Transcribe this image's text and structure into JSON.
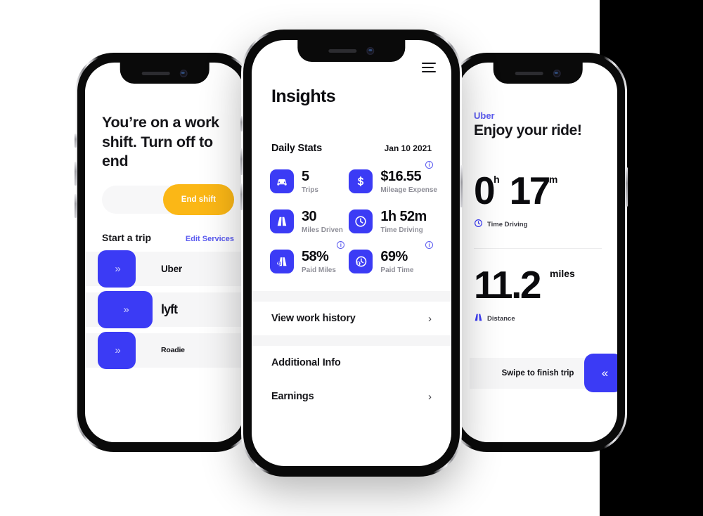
{
  "background": {
    "left_color": "#ffffff",
    "right_panel_color": "#000000"
  },
  "theme": {
    "accent_blue": "#3b3bf5",
    "link_blue": "#5b5bf0",
    "accent_yellow": "#fbb716",
    "text_dark": "#0c0c10",
    "muted": "#8f8f98",
    "band": "#f5f5f6"
  },
  "left_phone": {
    "heading": "You’re on a work shift. Turn off to end",
    "end_shift_label": "End shift",
    "start_trip_label": "Start a trip",
    "edit_services_label": "Edit Services",
    "services": [
      {
        "name": "Uber",
        "swipe_icon": "chevrons-right-icon"
      },
      {
        "name": "lyft",
        "swipe_icon": "chevrons-right-icon"
      },
      {
        "name": "Roadie",
        "swipe_icon": "chevrons-right-icon"
      }
    ]
  },
  "center_phone": {
    "menu_icon": "hamburger-menu-icon",
    "title": "Insights",
    "daily_stats_title": "Daily Stats",
    "date": "Jan 10 2021",
    "stats": [
      {
        "value": "5",
        "label": "Trips",
        "icon": "car-icon",
        "info": false
      },
      {
        "value": "$16.55",
        "label": "Mileage Expense",
        "icon": "dollar-icon",
        "info": true
      },
      {
        "value": "30",
        "label": "Miles  Driven",
        "icon": "road-icon",
        "info": false
      },
      {
        "value": "1h 52m",
        "label": "Time Driving",
        "icon": "clock-icon",
        "info": false
      },
      {
        "value": "58%",
        "label": "Paid Miles",
        "icon": "road-paid-icon",
        "info": true
      },
      {
        "value": "69%",
        "label": "Paid Time",
        "icon": "clock-paid-icon",
        "info": true
      }
    ],
    "info_badge_glyph": "i",
    "rows": [
      {
        "label": "View work history",
        "chevron": "chevron-right-icon",
        "kind": "link"
      },
      {
        "label": "Additional Info",
        "chevron": "",
        "kind": "header"
      },
      {
        "label": "Earnings",
        "chevron": "chevron-right-icon",
        "kind": "link"
      }
    ]
  },
  "right_phone": {
    "brand": "Uber",
    "heading": "Enjoy your ride!",
    "time": {
      "hours": "0",
      "hours_unit": "h",
      "minutes": "17",
      "minutes_unit": "m",
      "label": "Time Driving",
      "icon": "clock-icon"
    },
    "distance": {
      "value": "11.2",
      "unit": "miles",
      "label": "Distance",
      "icon": "road-icon"
    },
    "swipe_label": "Swipe to finish trip",
    "swipe_icon": "chevrons-left-icon"
  }
}
